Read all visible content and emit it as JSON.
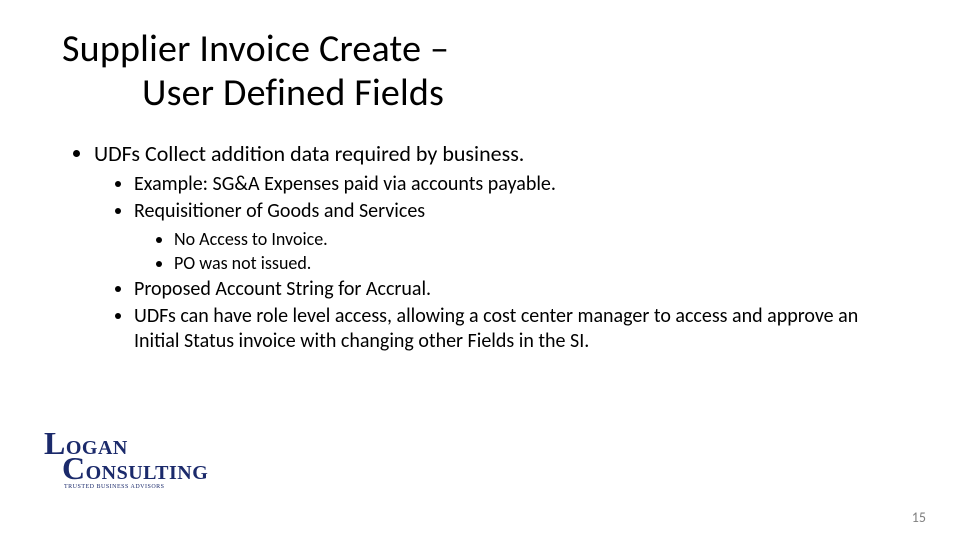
{
  "title": {
    "line1": "Supplier Invoice Create –",
    "line2": "User Defined Fields"
  },
  "bullets": {
    "b1": "UDFs Collect addition data required by business.",
    "b1_1": "Example:  SG&A Expenses paid via accounts payable.",
    "b1_2": "Requisitioner of Goods and Services",
    "b1_2_1": "No Access to Invoice.",
    "b1_2_2": "PO was not issued.",
    "b1_3": "Proposed Account String for Accrual.",
    "b1_4": "UDFs can have role level access, allowing a cost center manager to access and approve an Initial Status invoice with changing other Fields in the SI."
  },
  "logo": {
    "line1_big": "L",
    "line1_rest": "OGAN",
    "line2_big": "C",
    "line2_rest": "ONSULTING",
    "tagline": "TRUSTED BUSINESS ADVISORS"
  },
  "page_number": "15"
}
